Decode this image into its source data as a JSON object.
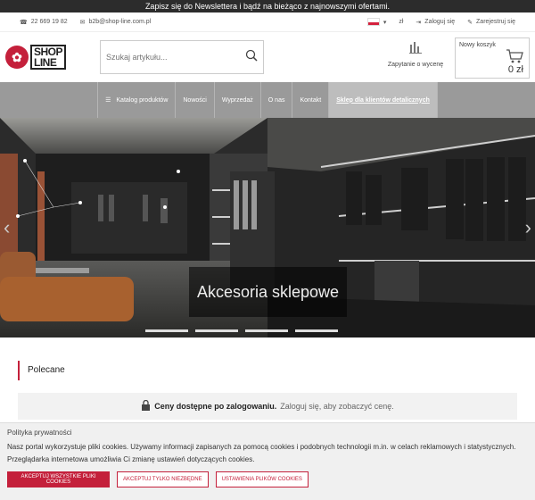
{
  "topbar": {
    "text": "Zapisz się do Newslettera i bądź na bieżąco z najnowszymi ofertami."
  },
  "info": {
    "phone": "22 669 19 82",
    "email": "b2b@shop-line.com.pl",
    "currency": "zł",
    "login": "Zaloguj się",
    "register": "Zarejestruj się"
  },
  "logo": {
    "line1": "SHOP",
    "line2": "LINE"
  },
  "search": {
    "placeholder": "Szukaj artykułu..."
  },
  "compare": {
    "label": "Zapytanie o wycenę"
  },
  "cart": {
    "label": "Nowy koszyk",
    "value": "0 zł"
  },
  "nav": {
    "items": [
      "Katalog produktów",
      "Nowości",
      "Wyprzedaż",
      "O nas",
      "Kontakt",
      "Sklep dla klientów detalicznych"
    ]
  },
  "hero": {
    "caption": "Akcesoria sklepowe",
    "slides": 5,
    "active_slide": 3
  },
  "featured": {
    "title": "Polecane"
  },
  "prices": {
    "bold": "Ceny dostępne po zalogowaniu.",
    "rest": "Zaloguj się, aby zobaczyć cenę."
  },
  "cookie": {
    "title": "Polityka prywatności",
    "line1": "Nasz portal wykorzystuje pliki cookies. Używamy informacji zapisanych za pomocą cookies i podobnych technologii m.in. w celach reklamowych i statystycznych.",
    "line2": "Przeglądarka internetowa umożliwia Ci zmianę ustawień dotyczących cookies.",
    "accept_all": "AKCEPTUJ WSZYSTKIE PLIKI COOKIES",
    "accept_needed": "AKCEPTUJ TYLKO NIEZBĘDNE",
    "settings": "USTAWIENIA PLIKÓW COOKIES"
  },
  "colors": {
    "brand": "#c4203b",
    "nav": "#9a9a9a",
    "topbar": "#2c2c2c"
  }
}
